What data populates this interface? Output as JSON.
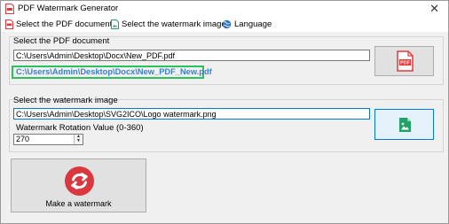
{
  "window": {
    "title": "PDF Watermark Generator"
  },
  "menu": {
    "select_pdf": "Select the PDF document",
    "select_watermark": "Select the watermark image",
    "language": "Language"
  },
  "pdf_group": {
    "label": "Select the PDF document",
    "input_path": "C:\\Users\\Admin\\Desktop\\Docx\\New_PDF.pdf",
    "output_path": "C:\\Users\\Admin\\Desktop\\Docx\\New_PDF_New.pdf"
  },
  "watermark_group": {
    "label": "Select the watermark image",
    "image_path": "C:\\Users\\Admin\\Desktop\\SVG2ICO\\Logo watermark.png",
    "rotation_label": "Watermark Rotation Value (0-360)",
    "rotation_value": "270"
  },
  "actions": {
    "make_watermark": "Make a watermark"
  },
  "colors": {
    "pdf_red": "#e03a3a",
    "image_green": "#21a366",
    "highlight_green": "#2cc15a",
    "link_blue": "#3a7fd0",
    "focus_blue": "#0078d7"
  }
}
